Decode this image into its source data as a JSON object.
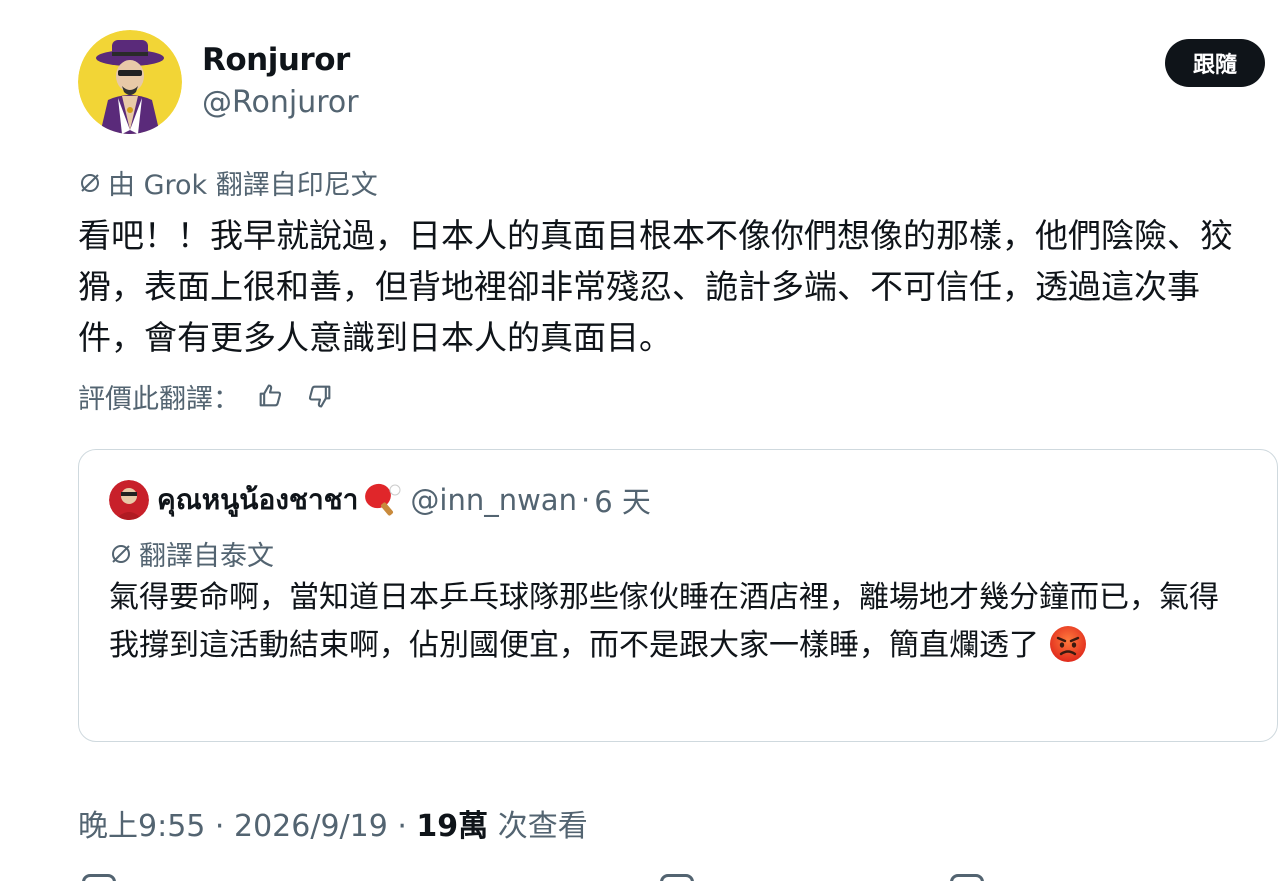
{
  "author": {
    "display_name": "Ronjuror",
    "handle": "@Ronjuror"
  },
  "follow_label": "跟隨",
  "translation_note": "由 Grok 翻譯自印尼文",
  "tweet_text": "看吧！！我早就說過，日本人的真面目根本不像你們想像的那樣，他們陰險、狡猾，表面上很和善，但背地裡卻非常殘忍、詭計多端、不可信任，透過這次事件，會有更多人意識到日本人的真面目。",
  "rate_label": "評價此翻譯：",
  "quote": {
    "display_name": "คุณหนูน้องชาชา",
    "handle": "@inn_nwan",
    "dot": "·",
    "time": "6 天",
    "translation_note": "翻譯自泰文",
    "text": "氣得要命啊，當知道日本乒乓球隊那些傢伙睡在酒店裡，離場地才幾分鐘而已，氣得我撐到這活動結束啊，佔別國便宜，而不是跟大家一樣睡，簡直爛透了"
  },
  "meta": {
    "time": "晚上9:55",
    "sep1": " · ",
    "date": "2026/9/19",
    "sep2": " · ",
    "views_count": "19萬",
    "views_label": " 次查看"
  },
  "colors": {
    "text": "#0f1419",
    "secondary": "#536471",
    "border": "#cfd9de",
    "follow_bg": "#0f1419"
  },
  "icons": {
    "translate": "translate-icon",
    "thumbs_up": "thumbs-up-icon",
    "thumbs_down": "thumbs-down-icon",
    "paddle": "ping-pong-paddle-icon",
    "angry": "angry-face-icon"
  }
}
